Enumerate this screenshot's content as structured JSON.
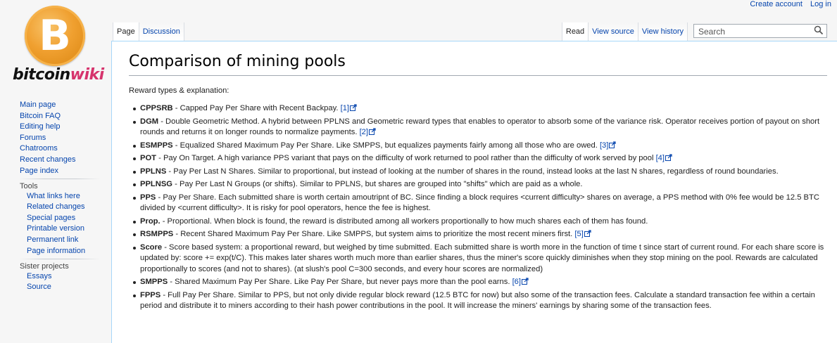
{
  "personal": {
    "create_account": "Create account",
    "log_in": "Log in"
  },
  "logo": {
    "symbol": "B",
    "word_part1": "bitcoin",
    "word_part2": "wiki"
  },
  "sidebar": {
    "nav": [
      "Main page",
      "Bitcoin FAQ",
      "Editing help",
      "Forums",
      "Chatrooms",
      "Recent changes",
      "Page index"
    ],
    "tools_heading": "Tools",
    "tools": [
      "What links here",
      "Related changes",
      "Special pages",
      "Printable version",
      "Permanent link",
      "Page information"
    ],
    "sister_heading": "Sister projects",
    "sister": [
      "Essays",
      "Source"
    ]
  },
  "tabs": {
    "page": "Page",
    "discussion": "Discussion",
    "read": "Read",
    "view_source": "View source",
    "view_history": "View history"
  },
  "search": {
    "placeholder": "Search"
  },
  "content": {
    "title": "Comparison of mining pools",
    "intro": "Reward types & explanation:",
    "items": [
      {
        "term": "CPPSRB",
        "desc": " - Capped Pay Per Share with Recent Backpay. ",
        "ref": "[1]"
      },
      {
        "term": "DGM",
        "desc": " - Double Geometric Method. A hybrid between PPLNS and Geometric reward types that enables to operator to absorb some of the variance risk. Operator receives portion of payout on short rounds and returns it on longer rounds to normalize payments. ",
        "ref": "[2]"
      },
      {
        "term": "ESMPPS",
        "desc": " - Equalized Shared Maximum Pay Per Share. Like SMPPS, but equalizes payments fairly among all those who are owed. ",
        "ref": "[3]"
      },
      {
        "term": "POT",
        "desc": " - Pay On Target. A high variance PPS variant that pays on the difficulty of work returned to pool rather than the difficulty of work served by pool ",
        "ref": "[4]"
      },
      {
        "term": "PPLNS",
        "desc": " - Pay Per Last N Shares. Similar to proportional, but instead of looking at the number of shares in the round, instead looks at the last N shares, regardless of round boundaries.",
        "ref": ""
      },
      {
        "term": "PPLNSG",
        "desc": " - Pay Per Last N Groups (or shifts). Similar to PPLNS, but shares are grouped into \"shifts\" which are paid as a whole.",
        "ref": ""
      },
      {
        "term": "PPS",
        "desc": " - Pay Per Share. Each submitted share is worth certain amoutripnt of BC. Since finding a block requires <current difficulty> shares on average, a PPS method with 0% fee would be 12.5 BTC divided by <current difficulty>. It is risky for pool operators, hence the fee is highest.",
        "ref": ""
      },
      {
        "term": "Prop.",
        "desc": " - Proportional. When block is found, the reward is distributed among all workers proportionally to how much shares each of them has found.",
        "ref": ""
      },
      {
        "term": "RSMPPS",
        "desc": " - Recent Shared Maximum Pay Per Share. Like SMPPS, but system aims to prioritize the most recent miners first. ",
        "ref": "[5]"
      },
      {
        "term": "Score",
        "desc": " - Score based system: a proportional reward, but weighed by time submitted. Each submitted share is worth more in the function of time t since start of current round. For each share score is updated by: score += exp(t/C). This makes later shares worth much more than earlier shares, thus the miner's score quickly diminishes when they stop mining on the pool. Rewards are calculated proportionally to scores (and not to shares). (at slush's pool C=300 seconds, and every hour scores are normalized)",
        "ref": ""
      },
      {
        "term": "SMPPS",
        "desc": " - Shared Maximum Pay Per Share. Like Pay Per Share, but never pays more than the pool earns. ",
        "ref": "[6]"
      },
      {
        "term": "FPPS",
        "desc": " - Full Pay Per Share. Similar to PPS, but not only divide regular block reward (12.5 BTC for now) but also some of the transaction fees. Calculate a standard transaction fee within a certain period and distribute it to miners according to their hash power contributions in the pool. It will increase the miners' earnings by sharing some of the transaction fees.",
        "ref": ""
      }
    ]
  },
  "colors": {
    "link": "#0645ad",
    "border": "#a7d7f9",
    "wiki_pink": "#d6336c",
    "coin": "#f0a030"
  },
  "icons": {
    "search": "magnifier-icon",
    "external": "external-link-icon"
  }
}
